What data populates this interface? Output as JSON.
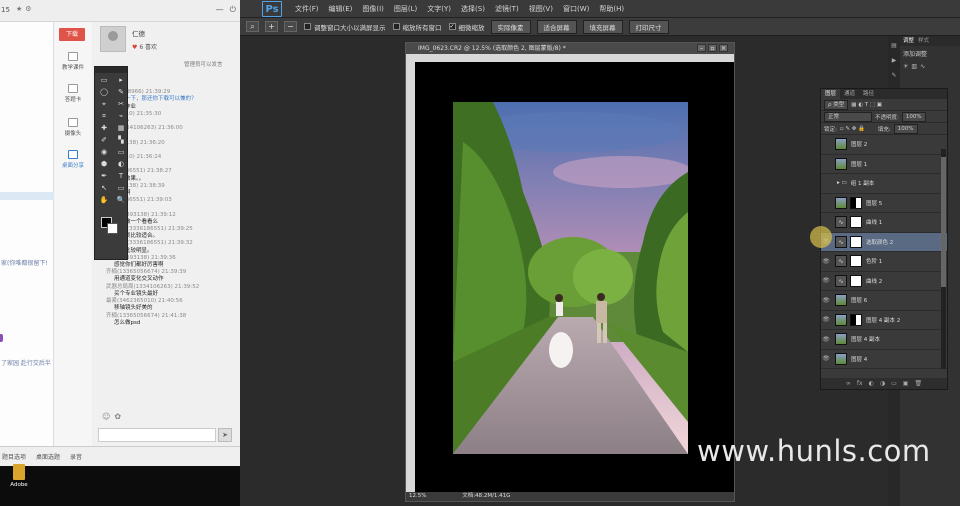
{
  "chat": {
    "title_num": "15",
    "download_label": "下载",
    "side_tools": [
      "教学课件",
      "答题卡",
      "摄像头",
      "桌面分享"
    ],
    "user_name": "仁德",
    "likes": "6 喜欢",
    "admin_link": "管理员可以发言",
    "left_text_1": "家(你唯都很留下!",
    "left_text_2": "了家园  赴行交后半",
    "messages": [
      {
        "meta": "(0)",
        "text": ""
      },
      {
        "meta": "美(12988966) 21:39:29",
        "text": "",
        "note": "加油一下，那还你下载可以兼的？"
      },
      {
        "meta": "",
        "text": "人习作业"
      },
      {
        "meta": "(3365010) 21:35:30",
        "text": ""
      },
      {
        "meta": "",
        "text": "个头~"
      },
      {
        "meta": "用禹(3334106263) 21:36:00",
        "text": ""
      },
      {
        "meta": "",
        "text": "太'号'"
      },
      {
        "meta": "(33393138) 21:36:20",
        "text": ""
      },
      {
        "meta": "",
        "text": "美啊"
      },
      {
        "meta": "(3365010) 21:36:24",
        "text": ""
      },
      {
        "meta": "",
        "text": "号"
      },
      {
        "meta": "(3336186551) 21:38:27",
        "text": ""
      },
      {
        "meta": "",
        "text": "移烛效果。。"
      },
      {
        "meta": "(33393138) 21:38:39",
        "text": ""
      },
      {
        "meta": "",
        "text": "什么啊"
      },
      {
        "meta": "(3336186551) 21:39:03",
        "text": ""
      },
      {
        "meta": "",
        "text": "修光"
      },
      {
        "meta": "想想(33393138) 21:39:12",
        "text": ""
      },
      {
        "meta": "",
        "text": "可以做一个看看么"
      },
      {
        "meta": "hill_Yqo(3336186551) 21:39:25",
        "text": ""
      },
      {
        "meta": "",
        "text": "大场景比较适合。"
      },
      {
        "meta": "hill_Yqo(3336186551) 21:39:32",
        "text": ""
      },
      {
        "meta": "",
        "text": "效果比较明显。"
      },
      {
        "meta": "想想(33393138) 21:39:36",
        "text": ""
      },
      {
        "meta": "",
        "text": "感觉你们都好厉害啊"
      },
      {
        "meta": "齐楠(13365056674) 21:39:39",
        "text": ""
      },
      {
        "meta": "",
        "text": "用通道变化交叉动作"
      },
      {
        "meta": "武器总局周(1334106263) 21:39:52",
        "text": ""
      },
      {
        "meta": "",
        "text": "买个专业镜头最好"
      },
      {
        "meta": "最紧(3462365010) 21:40:56",
        "text": ""
      },
      {
        "meta": "",
        "text": "移轴镜头好美的"
      },
      {
        "meta": "齐楠(13365056674) 21:41:38",
        "text": ""
      },
      {
        "meta": "",
        "text": "怎么做psd"
      }
    ],
    "bottom_items": [
      "题目选项",
      "桌面选题",
      "录音"
    ]
  },
  "toolbox": {
    "tools": [
      "▭",
      "▸",
      "◯",
      "✎",
      "⌖",
      "✂",
      "⌗",
      "⌁",
      "✚",
      "▦",
      "✐",
      "▚",
      "◉",
      "▭",
      "⬢",
      "◐",
      "✒",
      "T",
      "↖",
      "▭",
      "✋",
      "🔍",
      "",
      ""
    ]
  },
  "ps": {
    "logo": "Ps",
    "menu": [
      "文件(F)",
      "编辑(E)",
      "图像(I)",
      "图层(L)",
      "文字(Y)",
      "选择(S)",
      "滤镜(T)",
      "视图(V)",
      "窗口(W)",
      "帮助(H)"
    ],
    "options": {
      "check1": "调整窗口大小以满屏显示",
      "check2": "缩放所有窗口",
      "check3": "细微缩放",
      "btn1": "实际像素",
      "btn2": "适合屏幕",
      "btn3": "填充屏幕",
      "btn4": "打印尺寸"
    },
    "doc_tab": "IMG_0623.CR2 @ 12.5% (选取颜色 2, 图层蒙版/8) *",
    "status_zoom": "12.5%",
    "status_doc": "文档:48.2M/1.41G",
    "right_panel": {
      "tabs": [
        "调整",
        "样式"
      ],
      "item": "添加调整"
    },
    "layers": {
      "tabs": [
        "图层",
        "通道",
        "路径"
      ],
      "kind_label": "ρ 类型",
      "mode": "正常",
      "opacity_label": "不透明度:",
      "opacity": "100%",
      "lock_label": "锁定:",
      "fill_label": "填充:",
      "fill": "100%",
      "rows": [
        {
          "name": "图层 2",
          "type": "pixel",
          "visible": false,
          "selected": false
        },
        {
          "name": "图层 1",
          "type": "pixel",
          "visible": false,
          "selected": false
        },
        {
          "name": "组 1 副本",
          "type": "group",
          "visible": false,
          "selected": false
        },
        {
          "name": "图层 5",
          "type": "pixel-mask",
          "visible": false,
          "selected": false
        },
        {
          "name": "曲线 1",
          "type": "adjust",
          "visible": false,
          "selected": false
        },
        {
          "name": "选取颜色 2",
          "type": "adjust",
          "visible": true,
          "selected": true
        },
        {
          "name": "色阶 1",
          "type": "adjust",
          "visible": true,
          "selected": false
        },
        {
          "name": "曲线 2",
          "type": "adjust",
          "visible": true,
          "selected": false
        },
        {
          "name": "图层 6",
          "type": "pixel",
          "visible": true,
          "selected": false
        },
        {
          "name": "图层 4 副本 2",
          "type": "pixel-mask",
          "visible": true,
          "selected": false
        },
        {
          "name": "图层 4 副本",
          "type": "pixel",
          "visible": true,
          "selected": false
        },
        {
          "name": "图层 4",
          "type": "pixel",
          "visible": true,
          "selected": false
        }
      ],
      "bottom_icons": [
        "∞",
        "fx",
        "◐",
        "◑",
        "▭",
        "▣",
        "🗑"
      ]
    }
  },
  "watermark": "www.hunls.com",
  "desktop_icon_label": "Adobe"
}
